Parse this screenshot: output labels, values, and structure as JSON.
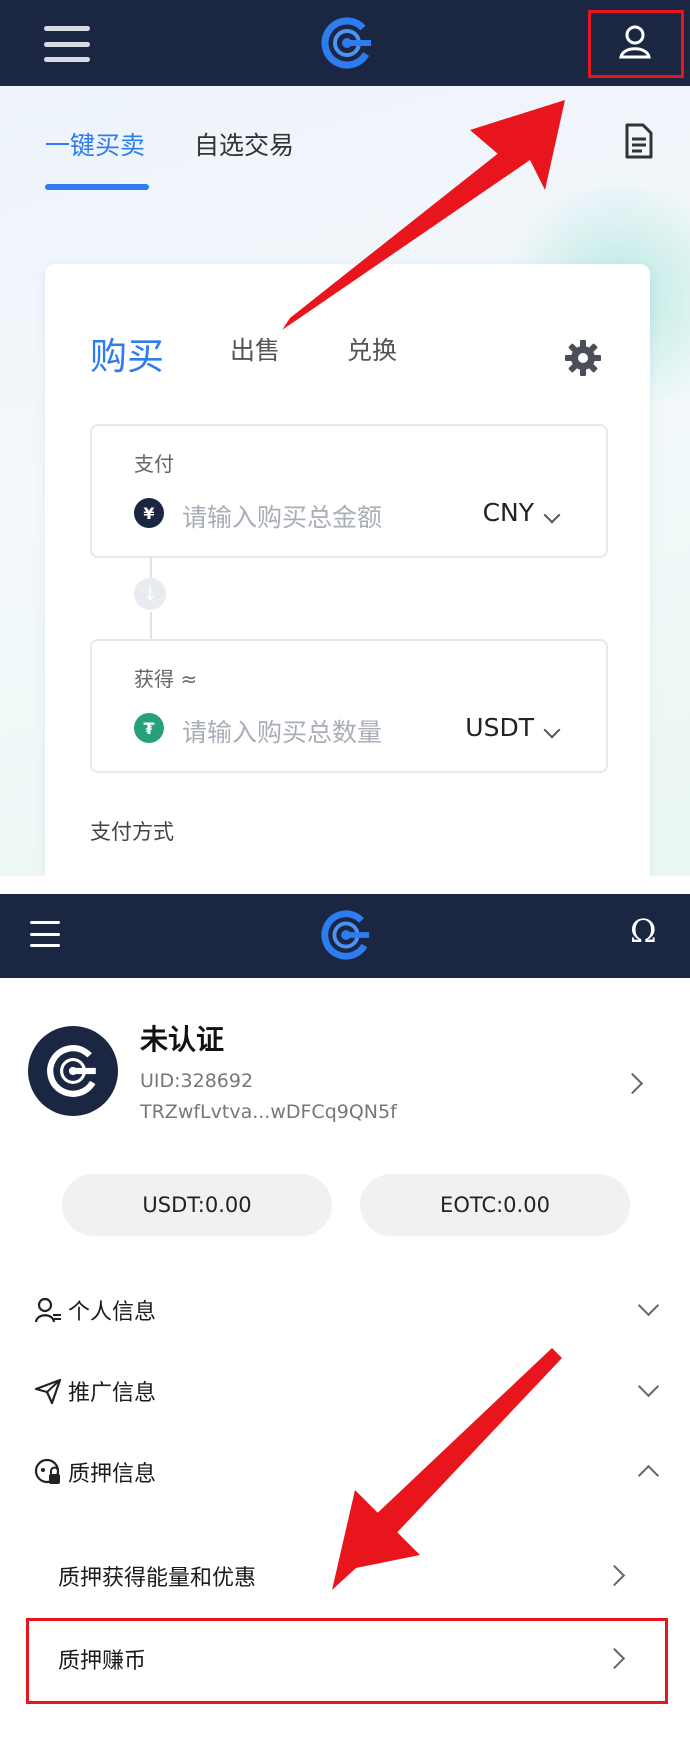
{
  "colors": {
    "header_bg": "#1b2742",
    "accent_blue": "#2d7cf0",
    "highlight_red": "#e8161c",
    "usdt_green": "#26a17b"
  },
  "screen1": {
    "tabs": [
      "一键买卖",
      "自选交易"
    ],
    "trade_tabs": [
      "购买",
      "出售",
      "兑换"
    ],
    "pay": {
      "label": "支付",
      "placeholder": "请输入购买总金额",
      "currency": "CNY",
      "coin_glyph": "¥"
    },
    "receive": {
      "label": "获得 ≈",
      "placeholder": "请输入购买总数量",
      "currency": "USDT",
      "coin_glyph": "₮"
    },
    "payment_method_label": "支付方式"
  },
  "screen2": {
    "profile": {
      "status": "未认证",
      "uid": "UID:328692",
      "address": "TRZwfLvtva...wDFCq9QN5f"
    },
    "balances": [
      "USDT:0.00",
      "EOTC:0.00"
    ],
    "menu": [
      {
        "label": "个人信息",
        "icon": "user-info-icon",
        "expanded": false
      },
      {
        "label": "推广信息",
        "icon": "send-icon",
        "expanded": false
      },
      {
        "label": "质押信息",
        "icon": "pledge-icon",
        "expanded": true
      }
    ],
    "pledge_submenu": [
      "质押获得能量和优惠",
      "质押赚币"
    ]
  }
}
